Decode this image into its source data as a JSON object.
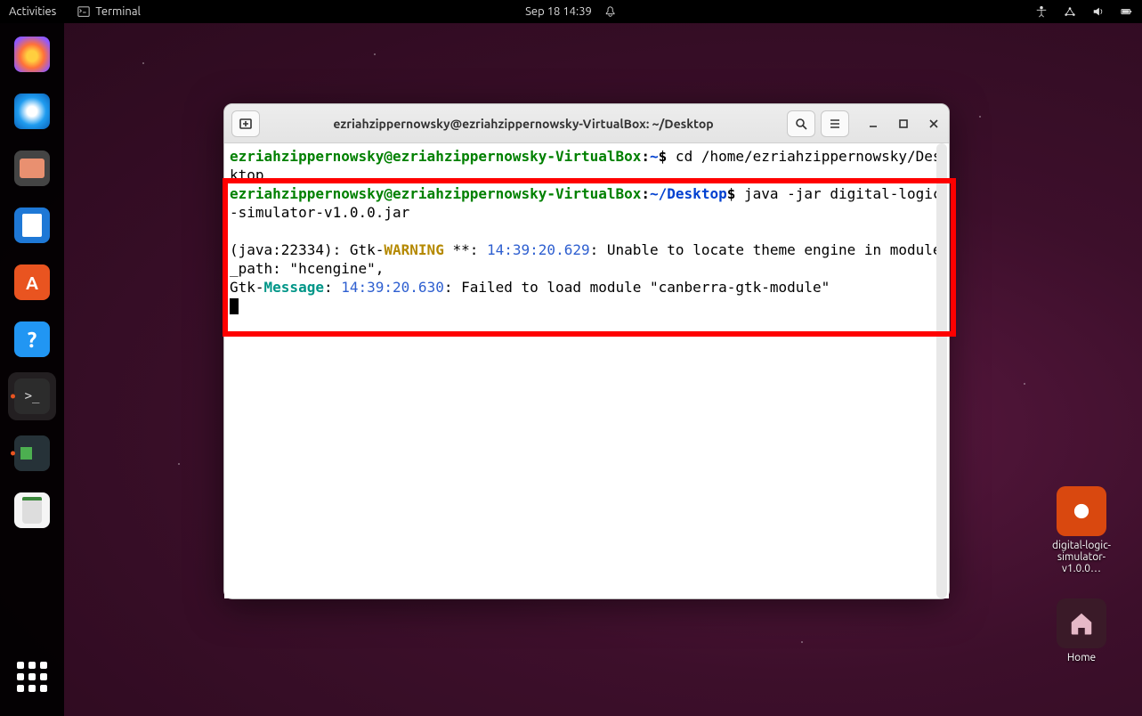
{
  "topbar": {
    "activities": "Activities",
    "app": "Terminal",
    "datetime": "Sep 18  14:39"
  },
  "dock": {
    "items": [
      {
        "name": "firefox"
      },
      {
        "name": "thunderbird"
      },
      {
        "name": "files"
      },
      {
        "name": "writer"
      },
      {
        "name": "software"
      },
      {
        "name": "help"
      },
      {
        "name": "terminal",
        "active": true
      },
      {
        "name": "simulator",
        "running": true
      },
      {
        "name": "trash"
      }
    ]
  },
  "desktop": {
    "jar_label": "digital-logic-simulator-v1.0.0…",
    "home_label": "Home"
  },
  "window": {
    "title": "ezriahzippernowsky@ezriahzippernowsky-VirtualBox: ~/Desktop"
  },
  "terminal": {
    "prompt_userhost": "ezriahzippernowsky@ezriahzippernowsky-VirtualBox",
    "prompt_sep": ":",
    "prompt_home": "~",
    "prompt_dollar": "$",
    "line1_path": "~",
    "line1_cmd": " cd /home/ezriahzippernowsky/Desktop",
    "line2_path": "~/Desktop",
    "line2_cmd": " java -jar digital-logic-simulator-v1.0.0.jar",
    "gtk_prefix": "(java:22334): Gtk-",
    "gtk_warning": "WARNING",
    "gtk_stars": " **: ",
    "gtk_ts1": "14:39:20.629",
    "gtk_rest1": ": Unable to locate theme engine in module_path: \"hcengine\",",
    "gtk_prefix2": "Gtk-",
    "gtk_message": "Message",
    "gtk_colon": ": ",
    "gtk_ts2": "14:39:20.630",
    "gtk_rest2": ": Failed to load module \"canberra-gtk-module\""
  }
}
